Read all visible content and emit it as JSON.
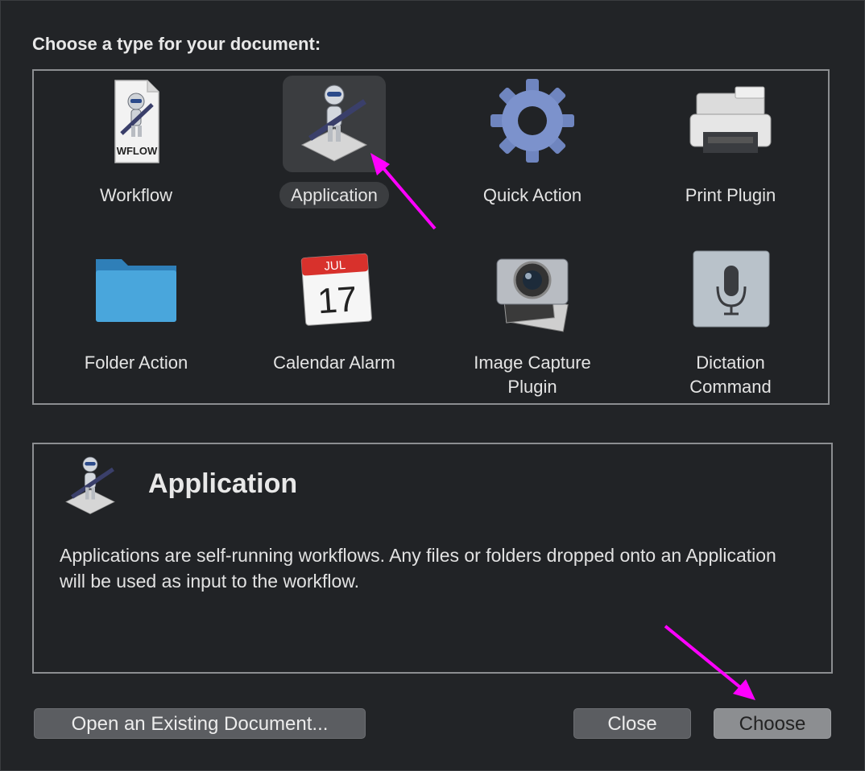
{
  "dialog": {
    "prompt": "Choose a type for your document:"
  },
  "types": [
    {
      "label": "Workflow",
      "icon": "workflow-file-icon",
      "badge": "WFLOW",
      "selected": false
    },
    {
      "label": "Application",
      "icon": "automator-robot-icon",
      "selected": true
    },
    {
      "label": "Quick Action",
      "icon": "gear-icon",
      "selected": false
    },
    {
      "label": "Print Plugin",
      "icon": "printer-icon",
      "selected": false
    },
    {
      "label": "Folder Action",
      "icon": "folder-icon",
      "selected": false
    },
    {
      "label": "Calendar Alarm",
      "icon": "calendar-icon",
      "month": "JUL",
      "day": "17",
      "selected": false
    },
    {
      "label_line1": "Image Capture",
      "label_line2": "Plugin",
      "icon": "camera-icon",
      "selected": false
    },
    {
      "label_line1": "Dictation",
      "label_line2": "Command",
      "icon": "microphone-icon",
      "selected": false
    }
  ],
  "info": {
    "title": "Application",
    "description": "Applications are self-running workflows. Any files or folders dropped onto an Application will be used as input to the workflow."
  },
  "buttons": {
    "open_existing": "Open an Existing Document...",
    "close": "Close",
    "choose": "Choose"
  },
  "colors": {
    "background": "#222427",
    "border": "#8c8e91",
    "selection": "#3b3d40",
    "annotation_arrow": "#ff00ff"
  }
}
